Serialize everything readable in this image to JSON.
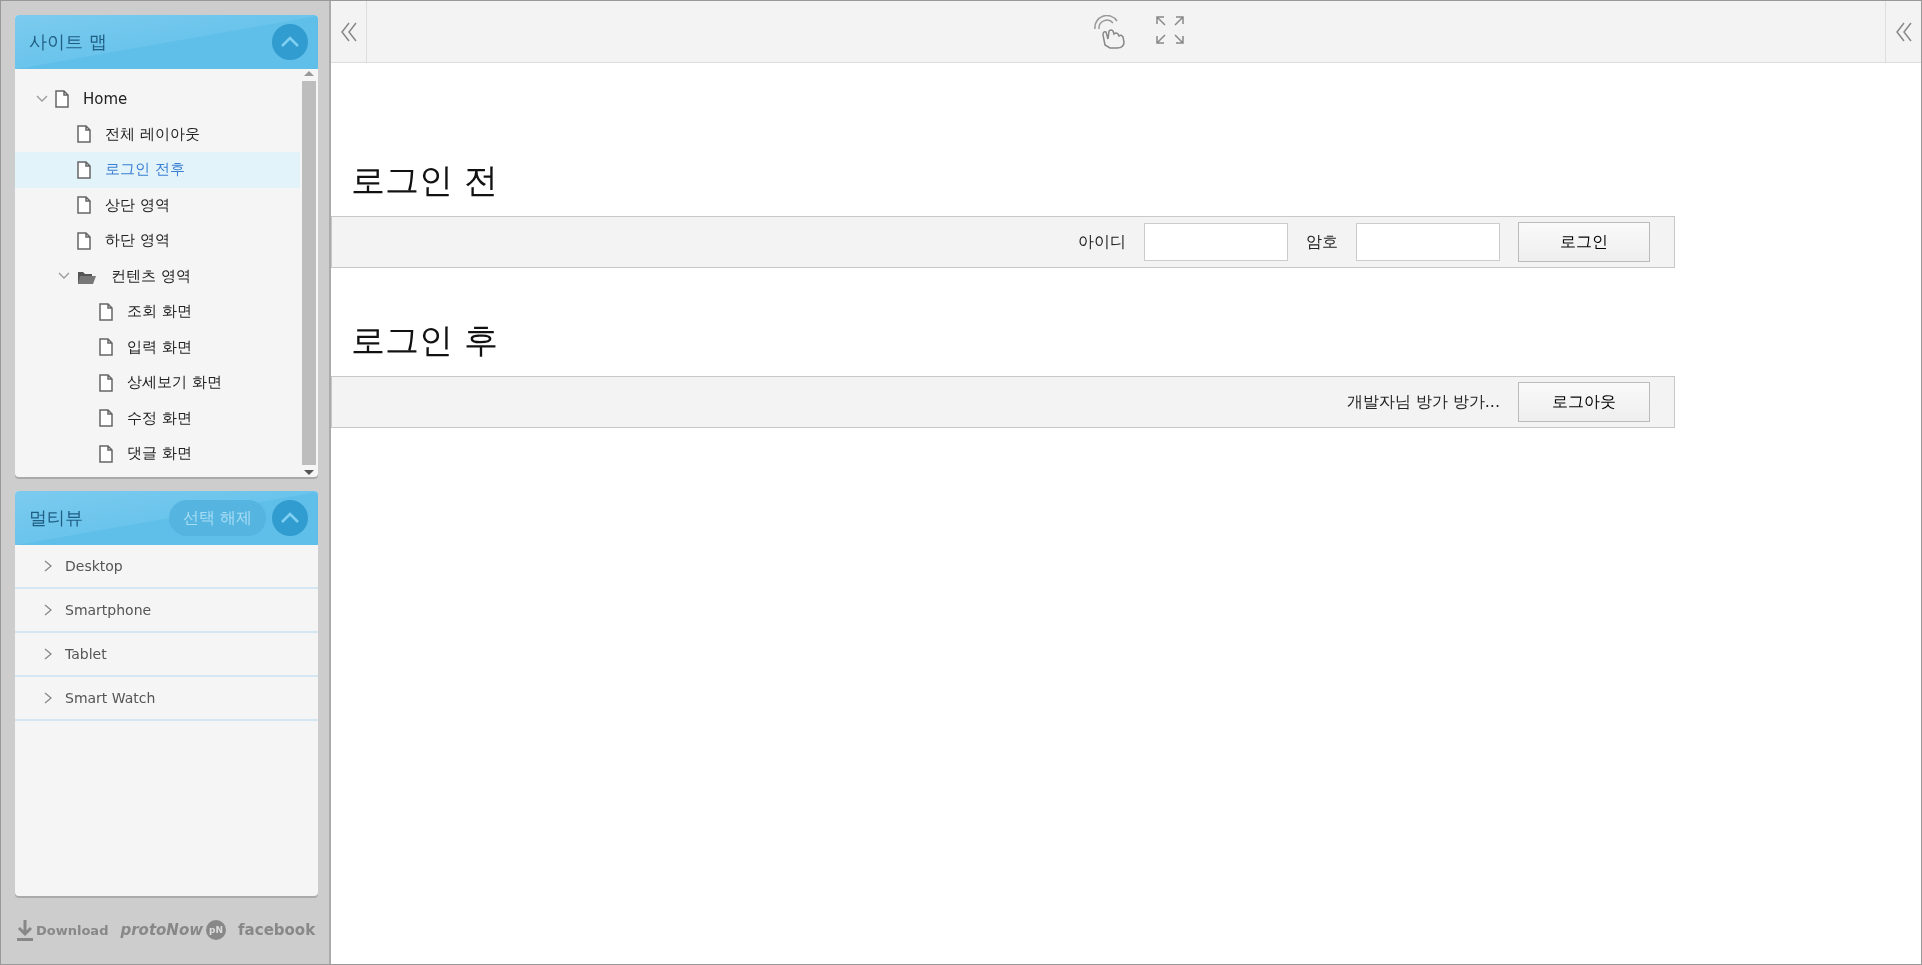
{
  "sitemap": {
    "title": "사이트 맵",
    "tree": [
      {
        "label": "Home",
        "kind": "page",
        "expanded": true,
        "selected": false,
        "children": [
          {
            "label": "전체 레이아웃",
            "kind": "page",
            "selected": false
          },
          {
            "label": "로그인 전후",
            "kind": "page",
            "selected": true
          },
          {
            "label": "상단 영역",
            "kind": "page",
            "selected": false
          },
          {
            "label": "하단 영역",
            "kind": "page",
            "selected": false
          },
          {
            "label": "컨텐츠 영역",
            "kind": "folder",
            "expanded": true,
            "selected": false,
            "children": [
              {
                "label": "조회 화면",
                "kind": "page",
                "selected": false
              },
              {
                "label": "입력 화면",
                "kind": "page",
                "selected": false
              },
              {
                "label": "상세보기 화면",
                "kind": "page",
                "selected": false
              },
              {
                "label": "수정 화면",
                "kind": "page",
                "selected": false
              },
              {
                "label": "댓글 화면",
                "kind": "page",
                "selected": false
              }
            ]
          }
        ]
      }
    ]
  },
  "multiview": {
    "title": "멀티뷰",
    "clear_button": "선택 해제",
    "items": [
      {
        "label": "Desktop",
        "expanded": false
      },
      {
        "label": "Smartphone",
        "expanded": false
      },
      {
        "label": "Tablet",
        "expanded": false
      },
      {
        "label": "Smart Watch",
        "expanded": false
      }
    ]
  },
  "footer": {
    "download": "Download",
    "brand": "protoNow",
    "brand_badge": "pN",
    "social": "facebook"
  },
  "sections": [
    {
      "heading": "로그인 전",
      "kind": "login",
      "id_label": "아이디",
      "password_label": "암호",
      "button": "로그인"
    },
    {
      "heading": "로그인 후",
      "kind": "logout",
      "greeting": "개발자님 방가 방가...",
      "button": "로그아웃"
    }
  ]
}
